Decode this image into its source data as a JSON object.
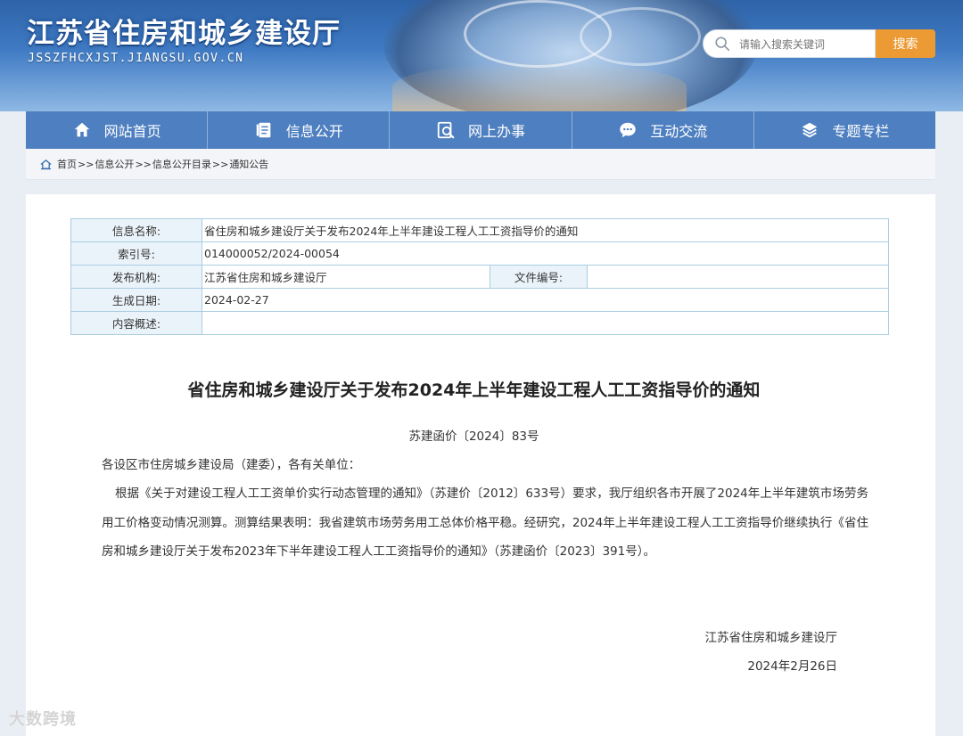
{
  "header": {
    "site_title": "江苏省住房和城乡建设厅",
    "site_domain": "JSSZFHCXJST.JIANGSU.GOV.CN",
    "search_placeholder": "请输入搜索关键词",
    "search_button": "搜索",
    "accent_color": "#ec9a33"
  },
  "nav": {
    "items": [
      {
        "label": "网站首页",
        "icon": "home-icon"
      },
      {
        "label": "信息公开",
        "icon": "document-icon"
      },
      {
        "label": "网上办事",
        "icon": "search-doc-icon"
      },
      {
        "label": "互动交流",
        "icon": "chat-icon"
      },
      {
        "label": "专题专栏",
        "icon": "layers-icon"
      }
    ]
  },
  "breadcrumb": {
    "items": [
      "首页",
      "信息公开",
      "信息公开目录",
      "通知公告"
    ],
    "separator": ">>"
  },
  "meta": {
    "name_label": "信息名称:",
    "name_value": "省住房和城乡建设厅关于发布2024年上半年建设工程人工工资指导价的通知",
    "index_label": "索引号:",
    "index_value": "014000052/2024-00054",
    "org_label": "发布机构:",
    "org_value": "江苏省住房和城乡建设厅",
    "file_no_label": "文件编号:",
    "file_no_value": "",
    "date_label": "生成日期:",
    "date_value": "2024-02-27",
    "summary_label": "内容概述:",
    "summary_value": ""
  },
  "article": {
    "title": "省住房和城乡建设厅关于发布2024年上半年建设工程人工工资指导价的通知",
    "doc_number": "苏建函价〔2024〕83号",
    "salutation": "各设区市住房城乡建设局（建委），各有关单位：",
    "body": "根据《关于对建设工程人工工资单价实行动态管理的通知》（苏建价〔2012〕633号）要求，我厅组织各市开展了2024年上半年建筑市场劳务用工价格变动情况测算。测算结果表明：我省建筑市场劳务用工总体价格平稳。经研究，2024年上半年建设工程人工工资指导价继续执行《省住房和城乡建设厅关于发布2023年下半年建设工程人工工资指导价的通知》（苏建函价〔2023〕391号）。",
    "signer": "江苏省住房和城乡建设厅",
    "date": "2024年2月26日"
  },
  "watermark": "大数跨境"
}
